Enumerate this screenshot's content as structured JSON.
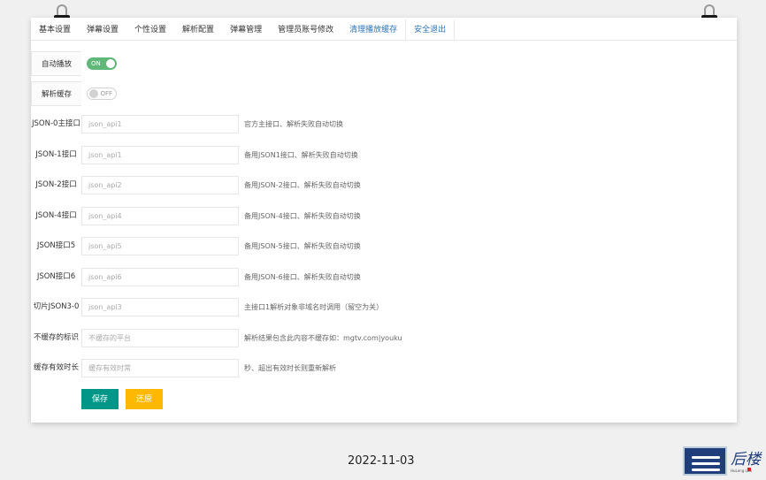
{
  "tabs": [
    {
      "label": "基本设置",
      "link": false
    },
    {
      "label": "弹幕设置",
      "link": false
    },
    {
      "label": "个性设置",
      "link": false
    },
    {
      "label": "解析配置",
      "link": false
    },
    {
      "label": "弹幕管理",
      "link": false
    },
    {
      "label": "管理员账号修改",
      "link": false
    },
    {
      "label": "清理播放缓存",
      "link": true
    },
    {
      "label": "安全退出",
      "link": true
    }
  ],
  "autoplay": {
    "label": "自动播放",
    "state": "ON"
  },
  "cache": {
    "label": "解析缓存",
    "state": "OFF"
  },
  "fields": [
    {
      "label": "JSON-0主接口",
      "placeholder": "json_api1",
      "tip": "官方主接口、解析失败自动切换"
    },
    {
      "label": "JSON-1接口",
      "placeholder": "json_api1",
      "tip": "备用JSON1接口、解析失败自动切换"
    },
    {
      "label": "JSON-2接口",
      "placeholder": "json_api2",
      "tip": "备用JSON-2接口、解析失败自动切换"
    },
    {
      "label": "JSON-4接口",
      "placeholder": "json_api4",
      "tip": "备用JSON-4接口、解析失败自动切换"
    },
    {
      "label": "JSON接口5",
      "placeholder": "json_api5",
      "tip": "备用JSON-5接口、解析失败自动切换"
    },
    {
      "label": "JSON接口6",
      "placeholder": "json_api6",
      "tip": "备用JSON-6接口、解析失败自动切换"
    },
    {
      "label": "切片JSON3-0",
      "placeholder": "json_api3",
      "tip": "主接口1解析对象非域名时调用（留空为关）"
    },
    {
      "label": "不缓存的标识",
      "placeholder": "不缓存的平台",
      "tip": "解析结果包含此内容不缓存如：mgtv.com|youku"
    },
    {
      "label": "缓存有效时长",
      "placeholder": "缓存有效时常",
      "tip": "秒、超出有效时长则重新解析"
    }
  ],
  "buttons": {
    "save": "保存",
    "reset": "还原"
  },
  "date": "2022-11-03",
  "logo": {
    "text": "后楼",
    "sub": "HuLeng Lou"
  },
  "colors": {
    "switch_on": "#5fb878",
    "save": "#009688",
    "reset": "#ffb800",
    "link": "#2f74b6"
  }
}
